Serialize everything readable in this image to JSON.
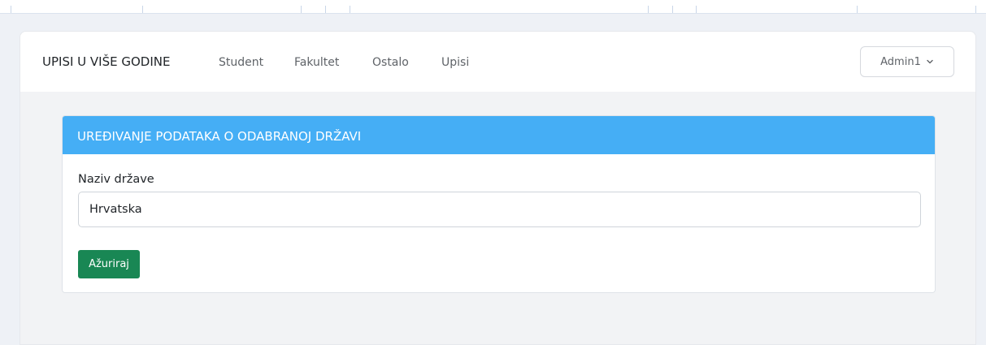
{
  "navbar": {
    "brand": "UPISI U VIŠE GODINE",
    "links": [
      "Student",
      "Fakultet",
      "Ostalo",
      "Upisi"
    ],
    "user_menu": {
      "label": "Admin1",
      "icon": "chevron-down-icon"
    }
  },
  "card": {
    "title": "UREĐIVANJE PODATAKA O ODABRANOJ DRŽAVI",
    "field_label": "Naziv države",
    "field_value": "Hrvatska",
    "submit_label": "Ažuriraj"
  },
  "colors": {
    "card_header": "#45aef5",
    "submit_button": "#198754",
    "background": "#f2f3f5"
  }
}
